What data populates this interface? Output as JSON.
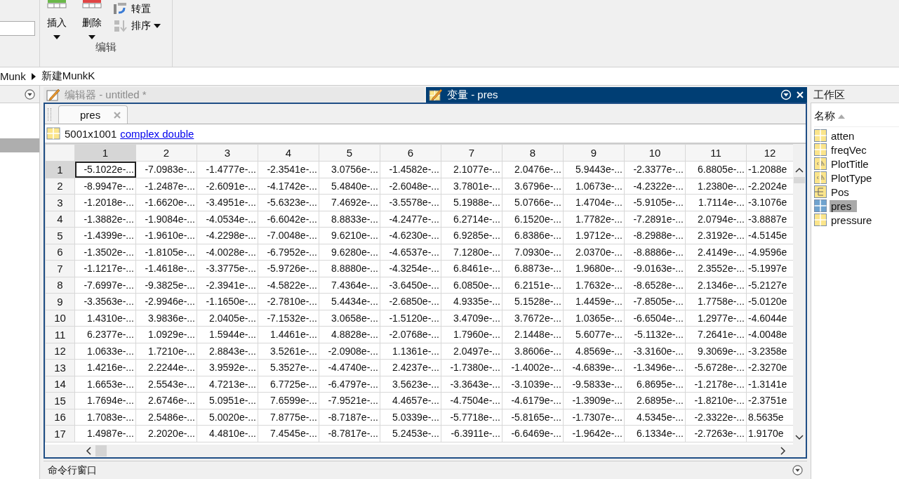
{
  "toolbar": {
    "buttons": [
      {
        "label": "插入",
        "kind": "insert",
        "dropdown": true
      },
      {
        "label": "删除",
        "kind": "delete",
        "dropdown": true
      }
    ],
    "small_buttons": [
      {
        "label": "转置",
        "kind": "transpose",
        "dropdown": false
      },
      {
        "label": "排序",
        "kind": "sort",
        "dropdown": true
      }
    ],
    "group_label": "编辑"
  },
  "breadcrumb": [
    "Munk",
    "新建MunkK"
  ],
  "editor_tabs": [
    {
      "label": "编辑器 - untitled *",
      "kind": "editor",
      "selected": false
    },
    {
      "label": "变量 - pres",
      "kind": "variable",
      "selected": true
    }
  ],
  "document_tabs": [
    {
      "label": "pres",
      "selected": true
    }
  ],
  "variable_info": {
    "size": "5001x1001",
    "class_link": "complex double"
  },
  "table": {
    "columns": [
      {
        "label": "1",
        "selected": true
      },
      {
        "label": "2",
        "selected": false
      },
      {
        "label": "3",
        "selected": false
      },
      {
        "label": "4",
        "selected": false
      },
      {
        "label": "5",
        "selected": false
      },
      {
        "label": "6",
        "selected": false
      },
      {
        "label": "7",
        "selected": false
      },
      {
        "label": "8",
        "selected": false
      },
      {
        "label": "9",
        "selected": false
      },
      {
        "label": "10",
        "selected": false
      },
      {
        "label": "11",
        "selected": false
      },
      {
        "label": "12",
        "selected": false
      }
    ],
    "rows": [
      {
        "label": "1",
        "selected": true,
        "cells": [
          "-5.1022e-...",
          "-7.0983e-...",
          "-1.4777e-...",
          "-2.3541e-...",
          "3.0756e-...",
          "-1.4582e-...",
          "2.1077e-...",
          "2.0476e-...",
          "5.9443e-...",
          "-2.3377e-...",
          "6.8805e-...",
          "-1.2088e"
        ]
      },
      {
        "label": "2",
        "selected": false,
        "cells": [
          "-8.9947e-...",
          "-1.2487e-...",
          "-2.6091e-...",
          "-4.1742e-...",
          "5.4840e-...",
          "-2.6048e-...",
          "3.7801e-...",
          "3.6796e-...",
          "1.0673e-...",
          "-4.2322e-...",
          "1.2380e-...",
          "-2.2024e"
        ]
      },
      {
        "label": "3",
        "selected": false,
        "cells": [
          "-1.2018e-...",
          "-1.6620e-...",
          "-3.4951e-...",
          "-5.6323e-...",
          "7.4692e-...",
          "-3.5578e-...",
          "5.1988e-...",
          "5.0766e-...",
          "1.4704e-...",
          "-5.9105e-...",
          "1.7114e-...",
          "-3.1076e"
        ]
      },
      {
        "label": "4",
        "selected": false,
        "cells": [
          "-1.3882e-...",
          "-1.9084e-...",
          "-4.0534e-...",
          "-6.6042e-...",
          "8.8833e-...",
          "-4.2477e-...",
          "6.2714e-...",
          "6.1520e-...",
          "1.7782e-...",
          "-7.2891e-...",
          "2.0794e-...",
          "-3.8887e"
        ]
      },
      {
        "label": "5",
        "selected": false,
        "cells": [
          "-1.4399e-...",
          "-1.9610e-...",
          "-4.2298e-...",
          "-7.0048e-...",
          "9.6210e-...",
          "-4.6230e-...",
          "6.9285e-...",
          "6.8386e-...",
          "1.9712e-...",
          "-8.2988e-...",
          "2.3192e-...",
          "-4.5145e"
        ]
      },
      {
        "label": "6",
        "selected": false,
        "cells": [
          "-1.3502e-...",
          "-1.8105e-...",
          "-4.0028e-...",
          "-6.7952e-...",
          "9.6280e-...",
          "-4.6537e-...",
          "7.1280e-...",
          "7.0930e-...",
          "2.0370e-...",
          "-8.8886e-...",
          "2.4149e-...",
          "-4.9596e"
        ]
      },
      {
        "label": "7",
        "selected": false,
        "cells": [
          "-1.1217e-...",
          "-1.4618e-...",
          "-3.3775e-...",
          "-5.9726e-...",
          "8.8880e-...",
          "-4.3254e-...",
          "6.8461e-...",
          "6.8873e-...",
          "1.9680e-...",
          "-9.0163e-...",
          "2.3552e-...",
          "-5.1997e"
        ]
      },
      {
        "label": "8",
        "selected": false,
        "cells": [
          "-7.6997e-...",
          "-9.3825e-...",
          "-2.3941e-...",
          "-4.5822e-...",
          "7.4364e-...",
          "-3.6450e-...",
          "6.0850e-...",
          "6.2151e-...",
          "1.7632e-...",
          "-8.6528e-...",
          "2.1346e-...",
          "-5.2127e"
        ]
      },
      {
        "label": "9",
        "selected": false,
        "cells": [
          "-3.3563e-...",
          "-2.9946e-...",
          "-1.1650e-...",
          "-2.7810e-...",
          "5.4434e-...",
          "-2.6850e-...",
          "4.9335e-...",
          "5.1528e-...",
          "1.4459e-...",
          "-7.8505e-...",
          "1.7758e-...",
          "-5.0120e"
        ]
      },
      {
        "label": "10",
        "selected": false,
        "cells": [
          "1.4310e-...",
          "3.9836e-...",
          "2.0405e-...",
          "-7.1532e-...",
          "3.0658e-...",
          "-1.5120e-...",
          "3.4709e-...",
          "3.7672e-...",
          "1.0365e-...",
          "-6.6504e-...",
          "1.2977e-...",
          "-4.6044e"
        ]
      },
      {
        "label": "11",
        "selected": false,
        "cells": [
          "6.2377e-...",
          "1.0929e-...",
          "1.5944e-...",
          "1.4461e-...",
          "4.8828e-...",
          "-2.0768e-...",
          "1.7960e-...",
          "2.1448e-...",
          "5.6077e-...",
          "-5.1132e-...",
          "7.2641e-...",
          "-4.0048e"
        ]
      },
      {
        "label": "12",
        "selected": false,
        "cells": [
          "1.0633e-...",
          "1.7210e-...",
          "2.8843e-...",
          "3.5261e-...",
          "-2.0908e-...",
          "1.1361e-...",
          "2.0497e-...",
          "3.8606e-...",
          "4.8569e-...",
          "-3.3160e-...",
          "9.3069e-...",
          "-3.2358e"
        ]
      },
      {
        "label": "13",
        "selected": false,
        "cells": [
          "1.4216e-...",
          "2.2244e-...",
          "3.9592e-...",
          "5.3527e-...",
          "-4.4740e-...",
          "2.4237e-...",
          "-1.7380e-...",
          "-1.4002e-...",
          "-4.6839e-...",
          "-1.3496e-...",
          "-5.6728e-...",
          "-2.3270e"
        ]
      },
      {
        "label": "14",
        "selected": false,
        "cells": [
          "1.6653e-...",
          "2.5543e-...",
          "4.7213e-...",
          "6.7725e-...",
          "-6.4797e-...",
          "3.5623e-...",
          "-3.3643e-...",
          "-3.1039e-...",
          "-9.5833e-...",
          "6.8695e-...",
          "-1.2178e-...",
          "-1.3141e"
        ]
      },
      {
        "label": "15",
        "selected": false,
        "cells": [
          "1.7694e-...",
          "2.6746e-...",
          "5.0951e-...",
          "7.6599e-...",
          "-7.9521e-...",
          "4.4657e-...",
          "-4.7504e-...",
          "-4.6179e-...",
          "-1.3909e-...",
          "2.6895e-...",
          "-1.8210e-...",
          "-2.3751e"
        ]
      },
      {
        "label": "16",
        "selected": false,
        "cells": [
          "1.7083e-...",
          "2.5486e-...",
          "5.0020e-...",
          "7.8775e-...",
          "-8.7187e-...",
          "5.0339e-...",
          "-5.7718e-...",
          "-5.8165e-...",
          "-1.7307e-...",
          "4.5345e-...",
          "-2.3322e-...",
          "8.5635e"
        ]
      },
      {
        "label": "17",
        "selected": false,
        "cells": [
          "1.4987e-...",
          "2.2020e-...",
          "4.4810e-...",
          "7.4545e-...",
          "-8.7817e-...",
          "5.2453e-...",
          "-6.3911e-...",
          "-6.6469e-...",
          "-1.9642e-...",
          "6.1334e-...",
          "-2.7263e-...",
          "1.9170e"
        ]
      }
    ]
  },
  "workspace": {
    "title": "工作区",
    "column_header": "名称",
    "items": [
      {
        "name": "atten",
        "kind": "matrix",
        "selected": false
      },
      {
        "name": "freqVec",
        "kind": "matrix",
        "selected": false
      },
      {
        "name": "PlotTitle",
        "kind": "char",
        "selected": false
      },
      {
        "name": "PlotType",
        "kind": "char",
        "selected": false
      },
      {
        "name": "Pos",
        "kind": "struct",
        "selected": false
      },
      {
        "name": "pres",
        "kind": "matrix",
        "selected": true
      },
      {
        "name": "pressure",
        "kind": "matrix",
        "selected": false
      }
    ]
  },
  "command_window": {
    "title": "命令行窗口"
  }
}
